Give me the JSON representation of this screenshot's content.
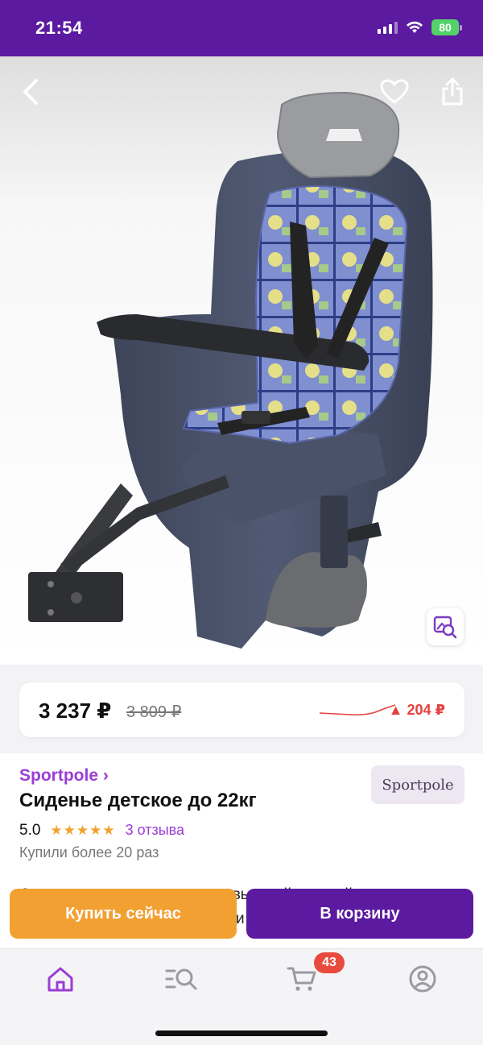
{
  "status_bar": {
    "time": "21:54",
    "battery": "80"
  },
  "product": {
    "title": "Сиденье детское до 22кг",
    "seller": "Sportpole ›",
    "seller_logo": "Sportpole",
    "rating": "5.0",
    "stars": "★★★★★",
    "reviews": "3 отзыва",
    "purchases": "Купили более 20 раз",
    "description": "Описание: детское сиденье с высокой спинкой, трехточечными регулируемыми страховочными"
  },
  "price": {
    "current": "3 237 ₽",
    "old": "3 809 ₽",
    "delta": "▲ 204 ₽"
  },
  "actions": {
    "buy_now": "Купить сейчас",
    "add_to_cart": "В корзину"
  },
  "tab_bar": {
    "cart_count": "43"
  },
  "colors": {
    "brand": "#5b1aa0",
    "accent_orange": "#f3a032",
    "link": "#9b3dd6",
    "price_up": "#e8413c"
  }
}
